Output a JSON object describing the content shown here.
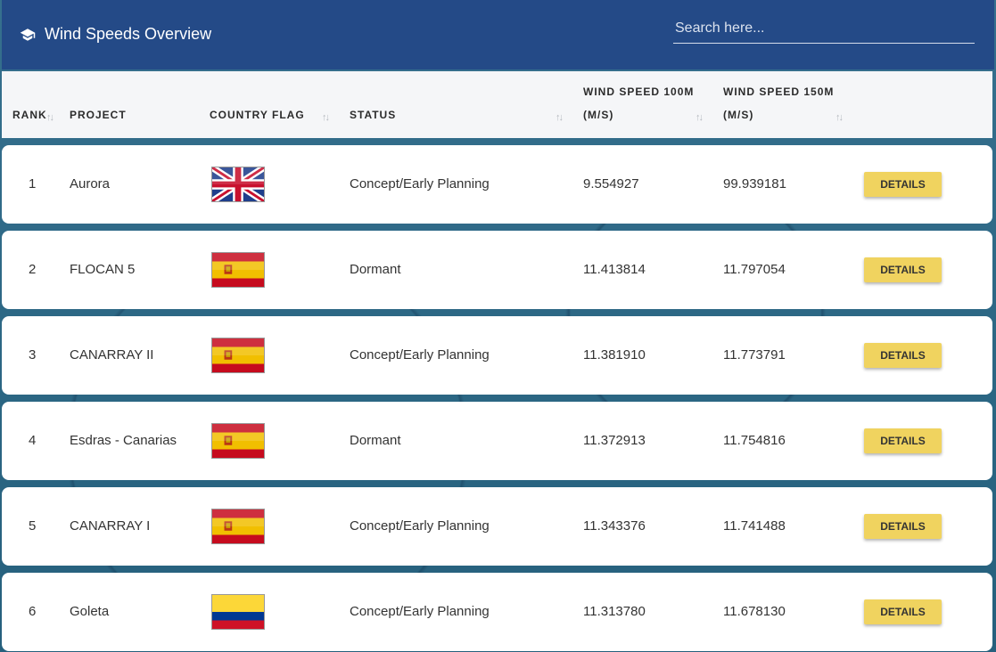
{
  "header": {
    "title": "Wind Speeds Overview",
    "icon": "graduation-cap-icon",
    "search_placeholder": "Search here..."
  },
  "colors": {
    "header_bg": "#244a87",
    "button_bg": "#f0d35f",
    "page_bg": "#2e6a8a"
  },
  "columns": {
    "rank": "RANK",
    "project": "PROJECT",
    "flag": "COUNTRY FLAG",
    "status": "STATUS",
    "ws100_line1": "WIND SPEED 100M",
    "ws100_line2": "(M/S)",
    "ws150_line1": "WIND SPEED 150M",
    "ws150_line2": "(M/S)"
  },
  "rows": [
    {
      "rank": "1",
      "project": "Aurora",
      "flag": "uk-flag",
      "status": "Concept/Early Planning",
      "ws100": "9.554927",
      "ws150": "99.939181",
      "button": "DETAILS"
    },
    {
      "rank": "2",
      "project": "FLOCAN 5",
      "flag": "spain-flag",
      "status": "Dormant",
      "ws100": "11.413814",
      "ws150": "11.797054",
      "button": "DETAILS"
    },
    {
      "rank": "3",
      "project": "CANARRAY II",
      "flag": "spain-flag",
      "status": "Concept/Early Planning",
      "ws100": "11.381910",
      "ws150": "11.773791",
      "button": "DETAILS"
    },
    {
      "rank": "4",
      "project": "Esdras - Canarias",
      "flag": "spain-flag",
      "status": "Dormant",
      "ws100": "11.372913",
      "ws150": "11.754816",
      "button": "DETAILS"
    },
    {
      "rank": "5",
      "project": "CANARRAY I",
      "flag": "spain-flag",
      "status": "Concept/Early Planning",
      "ws100": "11.343376",
      "ws150": "11.741488",
      "button": "DETAILS"
    },
    {
      "rank": "6",
      "project": "Goleta",
      "flag": "colombia-flag",
      "status": "Concept/Early Planning",
      "ws100": "11.313780",
      "ws150": "11.678130",
      "button": "DETAILS"
    }
  ]
}
